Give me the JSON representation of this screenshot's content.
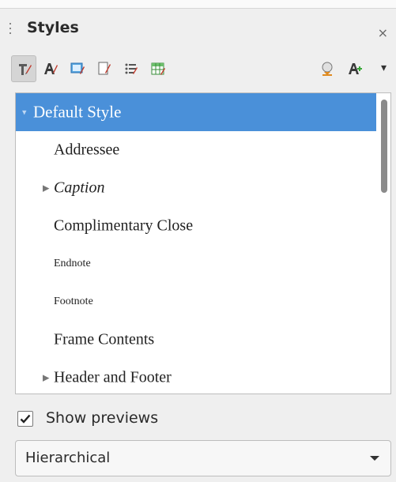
{
  "panel": {
    "title": "Styles",
    "close_glyph": "×"
  },
  "toolbar": {
    "buttons": [
      {
        "name": "paragraph-styles-icon",
        "active": true
      },
      {
        "name": "character-styles-icon",
        "active": false
      },
      {
        "name": "frame-styles-icon",
        "active": false
      },
      {
        "name": "page-styles-icon",
        "active": false
      },
      {
        "name": "list-styles-icon",
        "active": false
      },
      {
        "name": "table-styles-icon",
        "active": false
      },
      {
        "name": "fill-format-mode-icon",
        "active": false
      },
      {
        "name": "new-style-from-selection-icon",
        "active": false
      }
    ],
    "dropdown_glyph": "▾"
  },
  "tree": {
    "items": [
      {
        "label": "Default Style",
        "expander": "▾",
        "selected": true
      },
      {
        "label": "Addressee",
        "expander": "",
        "selected": false
      },
      {
        "label": "Caption",
        "expander": "▶",
        "selected": false
      },
      {
        "label": "Complimentary Close",
        "expander": "",
        "selected": false
      },
      {
        "label": "Endnote",
        "expander": "",
        "selected": false
      },
      {
        "label": "Footnote",
        "expander": "",
        "selected": false
      },
      {
        "label": "Frame Contents",
        "expander": "",
        "selected": false
      },
      {
        "label": "Header and Footer",
        "expander": "▶",
        "selected": false
      }
    ],
    "selection_color": "#4a90d9"
  },
  "show_previews": {
    "label": "Show previews",
    "checked": true
  },
  "filter": {
    "selected": "Hierarchical"
  }
}
